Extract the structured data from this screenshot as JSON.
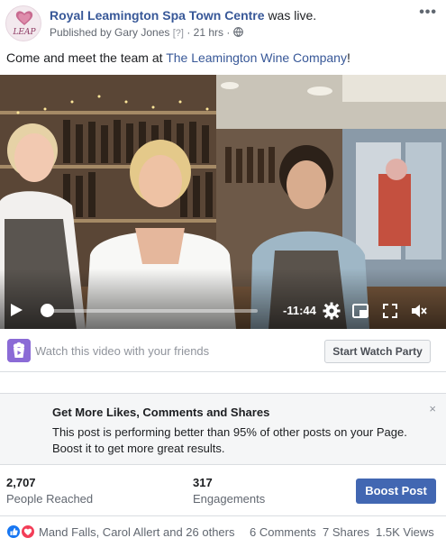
{
  "header": {
    "page_name": "Royal Leamington Spa Town Centre",
    "status_text": "was live.",
    "published_prefix": "Published by Gary Jones",
    "published_q": "[?]",
    "separator": "·",
    "time_ago": "21 hrs",
    "separator2": "·",
    "avatar_text": "LEAP",
    "more_icon": "more-horizontal-icon",
    "privacy_icon": "globe-icon"
  },
  "post": {
    "text_before": "Come and meet the team at ",
    "link_text": "The Leamington Wine Company",
    "text_after": "!"
  },
  "video": {
    "time_remaining": "-11:44",
    "progress": 0.0,
    "icons": [
      "play-icon",
      "settings-icon",
      "picture-in-picture-icon",
      "fullscreen-icon",
      "volume-icon"
    ]
  },
  "watch_party": {
    "text": "Watch this video with your friends",
    "button": "Start Watch Party",
    "icon": "watch-party-icon"
  },
  "promo": {
    "title": "Get More Likes, Comments and Shares",
    "line1": "This post is performing better than 95% of other posts on your Page.",
    "line2": "Boost it to get more great results.",
    "close": "×"
  },
  "stats": {
    "reached_value": "2,707",
    "reached_label": "People Reached",
    "engagements_value": "317",
    "engagements_label": "Engagements",
    "boost_button": "Boost Post"
  },
  "reactions": {
    "names": "Mand Falls, Carol Allert and 26 others",
    "comments": "6 Comments",
    "shares": "7 Shares",
    "views": "1.5K Views",
    "icons": [
      "like-icon",
      "love-icon"
    ],
    "colors": {
      "like": "#1877f2",
      "love": "#f33e58"
    }
  },
  "colors": {
    "link": "#385898",
    "boost": "#4267b2",
    "watch_party": "#8b6bd6"
  }
}
